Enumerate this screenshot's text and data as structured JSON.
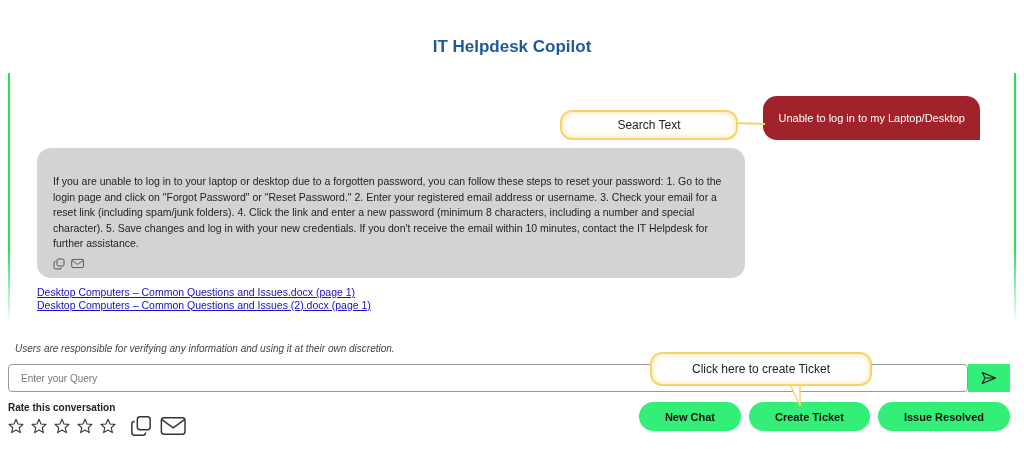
{
  "header": {
    "title": "IT Helpdesk Copilot"
  },
  "messages": [
    {
      "kind": "user",
      "text": "Unable to log in to my Laptop/Desktop"
    },
    {
      "kind": "bot",
      "text": "If you are unable to log in to your laptop or desktop due to a forgotten password, you can follow these steps to reset your password: 1. Go to the login page and click on \"Forgot Password\" or \"Reset Password.\" 2. Enter your registered email address or username. 3. Check your email for a reset link (including spam/junk folders). 4. Click the link and enter a new password (minimum 8 characters, including a number and special character). 5. Save changes and log in with your new credentials. If you don't receive the email within 10 minutes, contact the IT Helpdesk for further assistance."
    }
  ],
  "sources": [
    "Desktop Computers – Common Questions and Issues.docx (page 1)",
    "Desktop Computers – Common Questions and Issues (2).docx (page 1)"
  ],
  "callouts": [
    {
      "kind": "search",
      "text": "Search Text"
    },
    {
      "kind": "ticket",
      "text": "Click here to create Ticket"
    }
  ],
  "disclaimer": "Users are responsible for verifying any information and using it at their own discretion.",
  "query": {
    "placeholder": "Enter your Query"
  },
  "rating": {
    "label": "Rate this conversation",
    "stars": 0
  },
  "buttons": [
    "New Chat",
    "Create Ticket",
    "Issue Resolved"
  ]
}
